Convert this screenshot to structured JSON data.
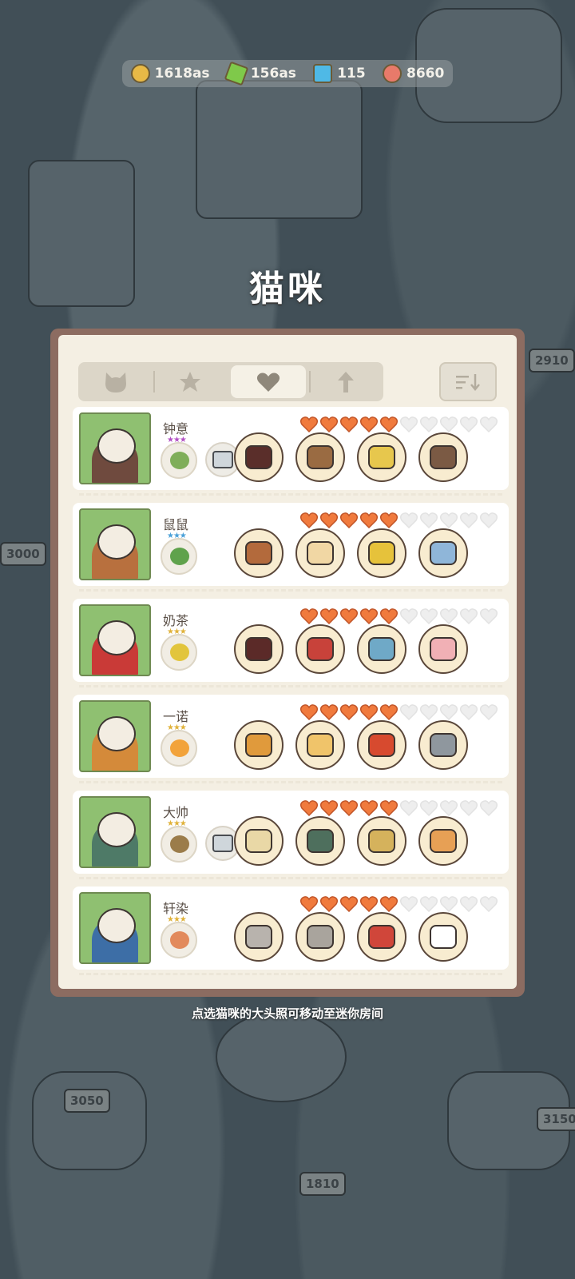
{
  "currency": [
    {
      "name": "coin",
      "value": "1618as",
      "color": "#e8b946"
    },
    {
      "name": "energy",
      "value": "156as",
      "color": "#7fc94a"
    },
    {
      "name": "gem",
      "value": "115",
      "color": "#4fb9e6"
    },
    {
      "name": "shell",
      "value": "8660",
      "color": "#e87a6a"
    }
  ],
  "screen_title": "猫咪",
  "tabs": [
    {
      "icon": "cat-head-icon",
      "active": false
    },
    {
      "icon": "star-icon",
      "active": false
    },
    {
      "icon": "heart-icon",
      "active": true
    },
    {
      "icon": "arrow-up-icon",
      "active": false
    }
  ],
  "sort_icon": "sort-icon",
  "cats": [
    {
      "name": "钟意",
      "hearts": 5,
      "max_hearts": 10,
      "food_stars": 3,
      "food_color": "#7fae5a",
      "has_gift": true,
      "gift_icon": "camera-icon",
      "fur": "#6f4a3e",
      "items": [
        "top-hat",
        "vest",
        "yarn",
        "hedgehog"
      ]
    },
    {
      "name": "鼠鼠",
      "hearts": 5,
      "max_hearts": 10,
      "food_stars": 3,
      "food_color": "#5fa24c",
      "has_gift": false,
      "fur": "#b8703e",
      "items": [
        "antler-hood",
        "toast",
        "scooter",
        "unicorn-toy"
      ]
    },
    {
      "name": "奶茶",
      "hearts": 5,
      "max_hearts": 10,
      "food_stars": 3,
      "food_color": "#e2c53c",
      "has_gift": false,
      "fur": "#c93a37",
      "items": [
        "official-hat",
        "treasure-box",
        "fish-knife",
        "deer-toy"
      ]
    },
    {
      "name": "一诺",
      "hearts": 5,
      "max_hearts": 10,
      "food_stars": 3,
      "food_color": "#f2a33b",
      "has_gift": false,
      "fur": "#d48a3a",
      "items": [
        "tiger-hood",
        "tiger-vest",
        "robot-toy",
        "husky-toy"
      ]
    },
    {
      "name": "大帅",
      "hearts": 5,
      "max_hearts": 10,
      "food_stars": 3,
      "food_color": "#9b7c4a",
      "has_gift": true,
      "gift_icon": "pocket-watch-icon",
      "fur": "#4e7a67",
      "items": [
        "halo",
        "kimono",
        "fishing-rod",
        "taiyaki"
      ]
    },
    {
      "name": "轩染",
      "hearts": 5,
      "max_hearts": 10,
      "food_stars": 3,
      "food_color": "#e28a5c",
      "has_gift": false,
      "fur": "#3d6ea6",
      "items": [
        "roman-helmet",
        "armor",
        "red-toy",
        "rabbit-toy"
      ]
    }
  ],
  "hint": "点选猫咪的大头照可移动至迷你房间",
  "background_signs": [
    "2910",
    "3000",
    "3050",
    "1810",
    "3150"
  ],
  "colors": {
    "heart_on": "#f07a3d",
    "heart_off": "#eeeeee",
    "panel_border": "#8c6c61",
    "panel_bg": "#f4efe3"
  }
}
